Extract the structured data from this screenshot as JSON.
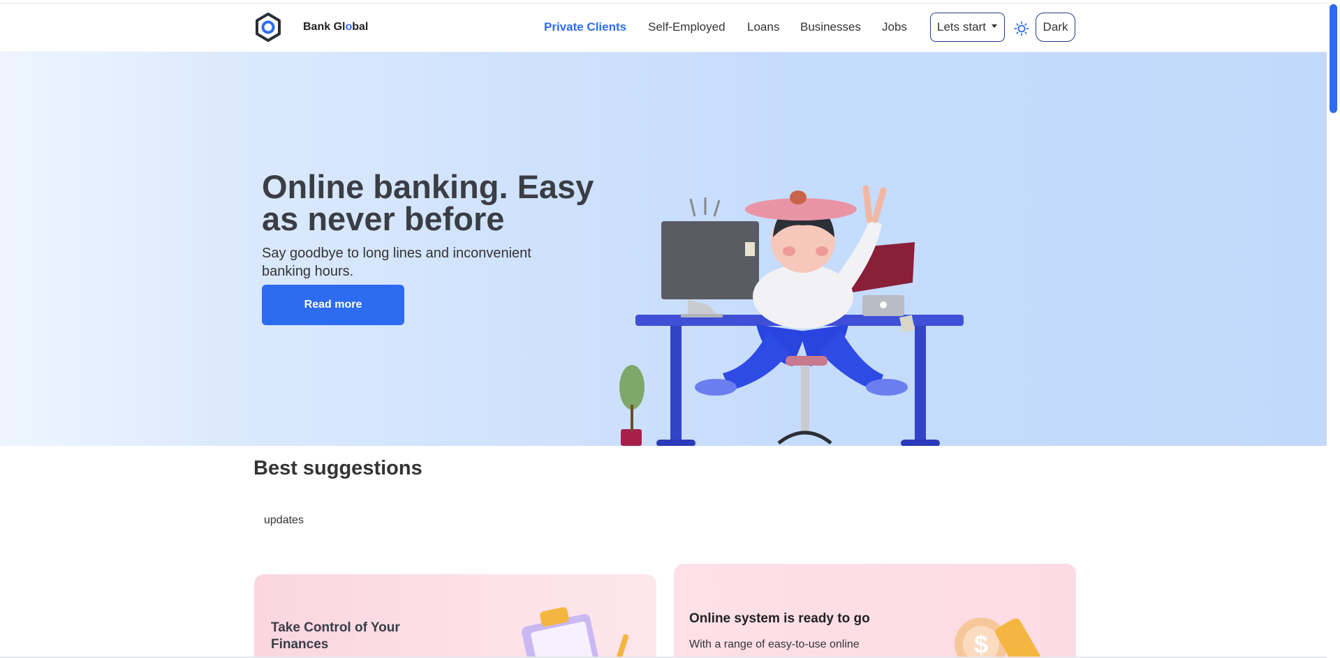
{
  "brand": {
    "name_prefix": "Bank Gl",
    "name_o": "o",
    "name_suffix": "bal"
  },
  "nav": {
    "items": [
      {
        "label": "Private Clients",
        "active": true
      },
      {
        "label": "Self-Employed",
        "active": false
      },
      {
        "label": "Loans",
        "active": false
      },
      {
        "label": "Businesses",
        "active": false
      },
      {
        "label": "Jobs",
        "active": false
      }
    ],
    "dropdown_label": "Lets start",
    "theme_toggle_label": "Dark",
    "theme_icon": "sun-icon"
  },
  "hero": {
    "title": "Online banking. Easy as never before",
    "subtitle": "Say goodbye to long lines and inconvenient banking hours.",
    "cta_label": "Read more"
  },
  "suggestions": {
    "title": "Best suggestions",
    "tag": "updates",
    "cards": [
      {
        "title": "Take Control of Your Finances",
        "text": ""
      },
      {
        "title": "Online system is ready to go",
        "text": "With a range of easy-to-use online"
      }
    ]
  },
  "colors": {
    "accent": "#2d6cf0",
    "text_dark": "#3a3d44",
    "hero_bg": "#c6dcfc",
    "card_pink": "#fde0e8"
  }
}
